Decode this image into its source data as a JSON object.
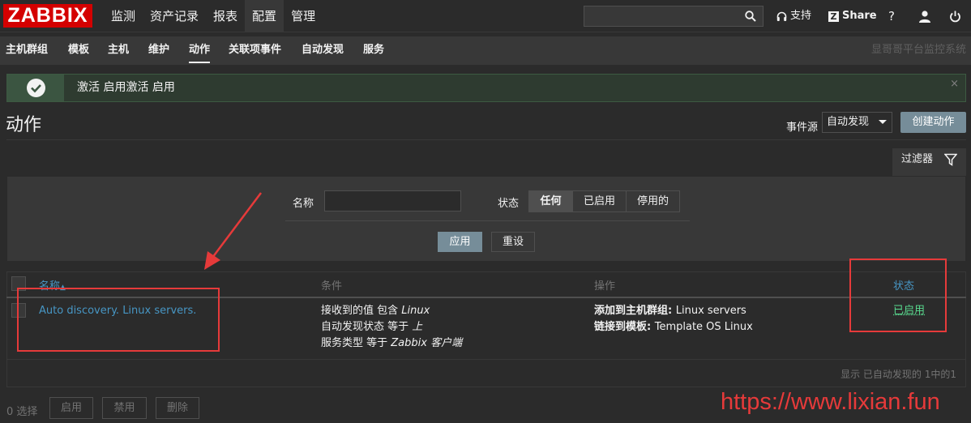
{
  "topbar": {
    "logo": "ZABBIX",
    "nav": [
      "监测",
      "资产记录",
      "报表",
      "配置",
      "管理"
    ],
    "active_nav": "配置",
    "support": "支持",
    "share_badge": "Z",
    "share": "Share",
    "help": "?"
  },
  "subnav": {
    "items": [
      "主机群组",
      "模板",
      "主机",
      "维护",
      "动作",
      "关联项事件",
      "自动发现",
      "服务"
    ],
    "active": "动作",
    "brand": "显哥哥平台监控系统"
  },
  "message": {
    "text": "激活 启用激活 启用",
    "close": "×"
  },
  "header": {
    "title": "动作",
    "event_source_label": "事件源",
    "event_source_value": "自动发现",
    "create_button": "创建动作"
  },
  "filter": {
    "tab_label": "过滤器",
    "name_label": "名称",
    "name_value": "",
    "status_label": "状态",
    "status_options": [
      "任何",
      "已启用",
      "停用的"
    ],
    "status_selected": "任何",
    "apply": "应用",
    "reset": "重设"
  },
  "table": {
    "headers": {
      "name": "名称",
      "sort_arrow": "▲",
      "conditions": "条件",
      "operations": "操作",
      "status": "状态"
    },
    "rows": [
      {
        "name": "Auto discovery. Linux servers.",
        "conditions": [
          {
            "prefix": "接收到的值 包含 ",
            "value": "Linux"
          },
          {
            "prefix": "自动发现状态 等于 ",
            "value": "上"
          },
          {
            "prefix": "服务类型 等于 ",
            "value": "Zabbix 客户端"
          }
        ],
        "operations": [
          {
            "label": "添加到主机群组: ",
            "value": "Linux servers"
          },
          {
            "label": "链接到模板: ",
            "value": "Template OS Linux"
          }
        ],
        "status": "已启用"
      }
    ],
    "footer": "显示 已自动发现的 1中的1"
  },
  "bottom": {
    "selected": "0 选择",
    "enable": "启用",
    "disable": "禁用",
    "delete": "删除"
  },
  "watermark": "https://www.lixian.fun",
  "colors": {
    "accent_red": "#d40000",
    "annotation_red": "#e63a3a",
    "link_blue": "#4796c4",
    "enabled_green": "#59db8f",
    "button_blue": "#768d99"
  }
}
